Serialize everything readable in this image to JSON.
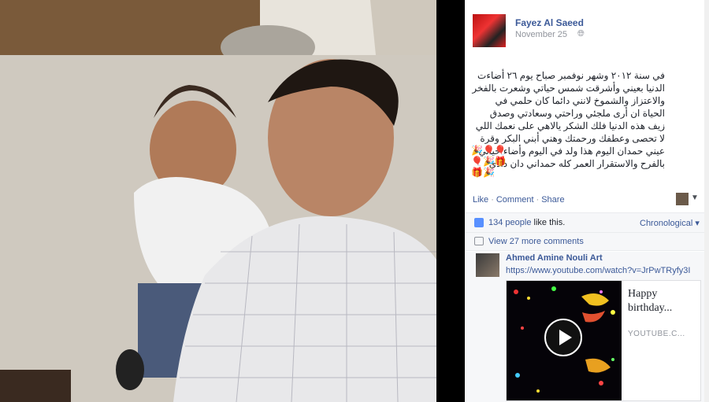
{
  "post": {
    "author": "Fayez Al Saeed",
    "date": "November 25",
    "privacy_icon": "globe-icon",
    "text": "في سنة ٢٠١٢ وشهر نوفمبر صباح يوم ٢٦ أضاءت الدنيا بعيني وأشرقت شمس حياتي وشعرت بالفخر والاعتزاز والشموخ لانني دائما كان حلمي في الحياة ان أرى ملجئي وراحتي وسعادتي وصدق زيف هذه الدنيا فلك الشكر يالاهي على نعمك اللي لا تحصى وعطفك ورحمتك وهني أبني البكر وقرة عيني حمدان اليوم هذا ولد في اليوم وأضاء حياتي بالفرح والاستقرار العمر كله حمداني دان دادي",
    "emojis": "🎉🎈🎈🎈🎉🎁🎁🎉"
  },
  "actions": {
    "like": "Like",
    "comment": "Comment",
    "share": "Share"
  },
  "likes": {
    "count": "134 people",
    "suffix": " like this.",
    "sort": "Chronological"
  },
  "more_comments": "View 27 more comments",
  "comment": {
    "author": "Ahmed Amine Nouli Art",
    "link": "https://www.youtube.com/watch?v=JrPwTRyfy3I",
    "preview_title": "Happy birthday...",
    "preview_source": "YOUTUBE.C..."
  },
  "colors": {
    "link": "#3b5998",
    "muted": "#90949c",
    "accent": "#5890ff"
  }
}
